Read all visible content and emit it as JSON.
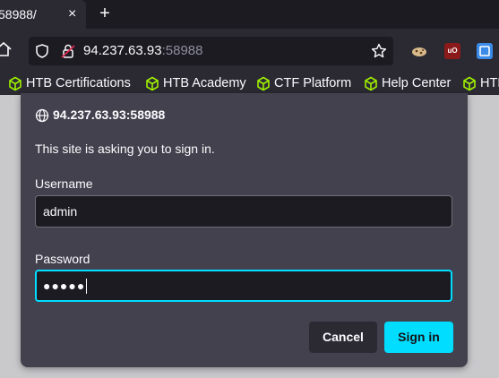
{
  "tab": {
    "title": "58988/",
    "close": "×",
    "new_tab": "+"
  },
  "address_bar": {
    "host": "94.237.63.93",
    "port": ":58988"
  },
  "extensions": {
    "ublock_text": "uO"
  },
  "bookmarks": [
    "HTB Certifications",
    "HTB Academy",
    "CTF Platform",
    "Help Center",
    "HTB"
  ],
  "dialog": {
    "origin": "94.237.63.93:58988",
    "message": "This site is asking you to sign in.",
    "username_label": "Username",
    "username_value": "admin",
    "password_label": "Password",
    "password_value": "●●●●●",
    "cancel_label": "Cancel",
    "signin_label": "Sign in"
  },
  "colors": {
    "accent": "#00ddff",
    "bookmark_icon": "#9fef00",
    "dialog_bg": "#42414d"
  }
}
